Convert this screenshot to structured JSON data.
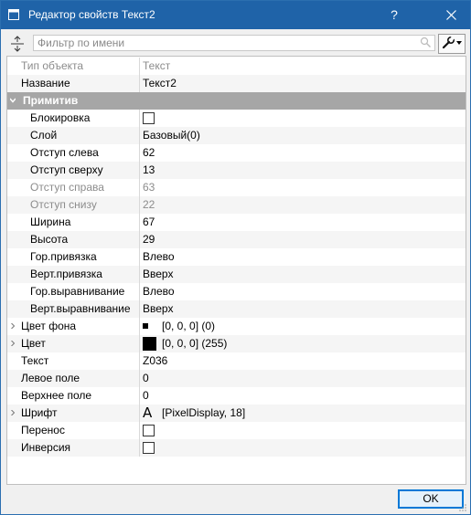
{
  "window": {
    "title": "Редактор свойств Текст2",
    "help_label": "?",
    "accent_color": "#1f63a8"
  },
  "toolbar": {
    "filter_placeholder": "Фильтр по имени",
    "sort_icon": "sort-arrows-icon",
    "search_icon": "search-icon",
    "settings_icon": "wrench-icon"
  },
  "properties": [
    {
      "name": "Тип объекта",
      "value": "Текст",
      "style": "gray"
    },
    {
      "name": "Название",
      "value": "Текст2",
      "style": "normal"
    },
    {
      "name": "Примитив",
      "value": "",
      "style": "section",
      "expanded": true
    },
    {
      "name": "Блокировка",
      "value": "",
      "style": "child",
      "kind": "checkbox",
      "checked": false
    },
    {
      "name": "Слой",
      "value": "Базовый(0)",
      "style": "child"
    },
    {
      "name": "Отступ слева",
      "value": "62",
      "style": "child"
    },
    {
      "name": "Отступ сверху",
      "value": "13",
      "style": "child"
    },
    {
      "name": "Отступ справа",
      "value": "63",
      "style": "child-gray"
    },
    {
      "name": "Отступ снизу",
      "value": "22",
      "style": "child-gray"
    },
    {
      "name": "Ширина",
      "value": "67",
      "style": "child"
    },
    {
      "name": "Высота",
      "value": "29",
      "style": "child"
    },
    {
      "name": "Гор.привязка",
      "value": "Влево",
      "style": "child"
    },
    {
      "name": "Верт.привязка",
      "value": "Вверх",
      "style": "child"
    },
    {
      "name": "Гор.выравнивание",
      "value": "Влево",
      "style": "child"
    },
    {
      "name": "Верт.выравнивание",
      "value": "Вверх",
      "style": "child"
    },
    {
      "name": "Цвет фона",
      "value": "[0, 0, 0] (0)",
      "style": "expandable",
      "kind": "color-small",
      "color": "#000000"
    },
    {
      "name": "Цвет",
      "value": "[0, 0, 0] (255)",
      "style": "expandable",
      "kind": "color-big",
      "color": "#000000"
    },
    {
      "name": "Текст",
      "value": "Z036",
      "style": "normal"
    },
    {
      "name": "Левое поле",
      "value": "0",
      "style": "normal"
    },
    {
      "name": "Верхнее поле",
      "value": "0",
      "style": "normal"
    },
    {
      "name": "Шрифт",
      "value": "[PixelDisplay, 18]",
      "style": "expandable",
      "kind": "font",
      "font_glyph": "A"
    },
    {
      "name": "Перенос",
      "value": "",
      "style": "normal",
      "kind": "checkbox",
      "checked": false
    },
    {
      "name": "Инверсия",
      "value": "",
      "style": "normal",
      "kind": "checkbox",
      "checked": false
    }
  ],
  "footer": {
    "ok_label": "OK"
  }
}
